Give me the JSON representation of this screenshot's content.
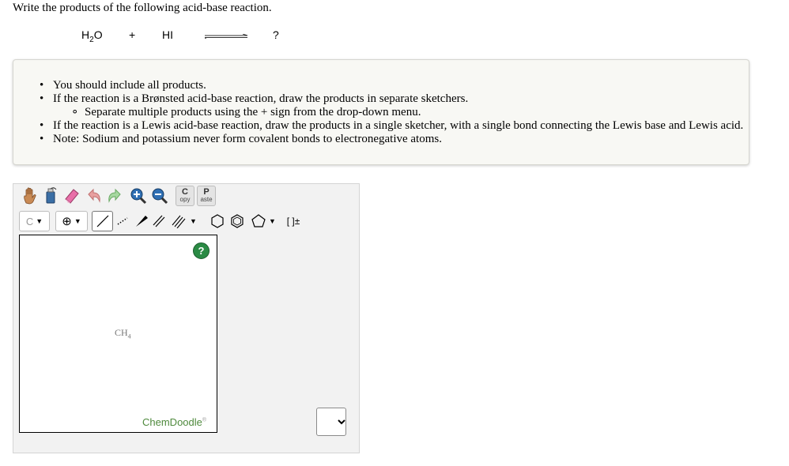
{
  "question": "Write the products of the following acid-base reaction.",
  "reaction": {
    "reactant1_base": "H",
    "reactant1_sub": "2",
    "reactant1_tail": "O",
    "plus": "+",
    "reactant2": "HI",
    "product": "?"
  },
  "instructions": [
    "You should include all products.",
    "If the reaction is a Brønsted acid-base reaction, draw the products in separate sketchers.",
    "Separate multiple products using the + sign from the drop-down menu.",
    "If the reaction is a Lewis acid-base reaction, draw the products in a single sketcher, with a single bond connecting the Lewis base and Lewis acid.",
    "Note: Sodium and potassium never form covalent bonds to electronegative atoms."
  ],
  "toolbar": {
    "copy_big": "C",
    "copy_small": "opy",
    "paste_big": "P",
    "paste_small": "aste",
    "element_label": "C",
    "bracket_label": "[ ]±"
  },
  "canvas": {
    "help_label": "?",
    "molecule_base": "CH",
    "molecule_sub": "4",
    "brand": "ChemDoodle",
    "brand_mark": "®"
  },
  "dropdown": {
    "selected": ""
  },
  "colors": {
    "help_green": "#2a8a44",
    "brand_green": "#4f8a3d",
    "panel_bg": "#f2f2f2",
    "instructions_bg": "#f8f8f4"
  }
}
